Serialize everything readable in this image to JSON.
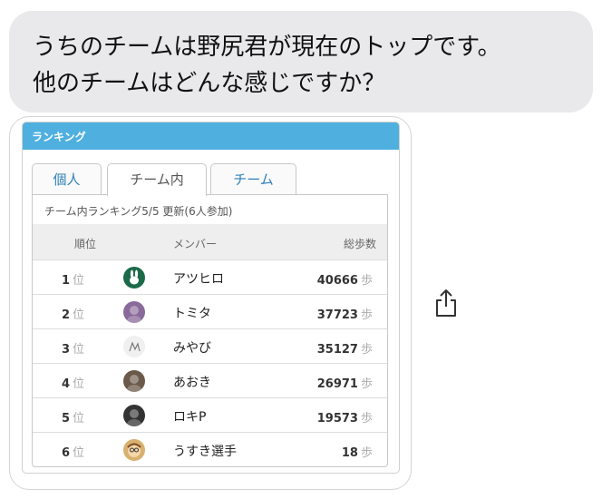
{
  "message": {
    "line1": "うちのチームは野尻君が現在のトップです。",
    "line2": "他のチームはどんな感じですか？"
  },
  "card": {
    "title": "ランキング",
    "tabs": [
      "個人",
      "チーム内",
      "チーム"
    ],
    "active_tab": "チーム内",
    "note": "チーム内ランキング5/5 更新(6人参加)",
    "headers": {
      "rank": "順位",
      "member": "メンバー",
      "steps": "総歩数"
    },
    "rank_unit": "位",
    "steps_unit": "歩",
    "rows": [
      {
        "rank": "1",
        "name": "アツヒロ",
        "steps": "40666",
        "avatar": "rabbit-avatar"
      },
      {
        "rank": "2",
        "name": "トミタ",
        "steps": "37723",
        "avatar": "photo-avatar"
      },
      {
        "rank": "3",
        "name": "みやび",
        "steps": "35127",
        "avatar": "photo-avatar"
      },
      {
        "rank": "4",
        "name": "あおき",
        "steps": "26971",
        "avatar": "photo-avatar"
      },
      {
        "rank": "5",
        "name": "ロキP",
        "steps": "19573",
        "avatar": "photo-avatar"
      },
      {
        "rank": "6",
        "name": "うすき選手",
        "steps": "18",
        "avatar": "cartoon-avatar"
      }
    ]
  },
  "icons": {
    "share": "share-icon"
  },
  "colors": {
    "header": "#4fb0e0",
    "tab_text": "#2e7fb8",
    "bubble": "#e9e9eb"
  }
}
